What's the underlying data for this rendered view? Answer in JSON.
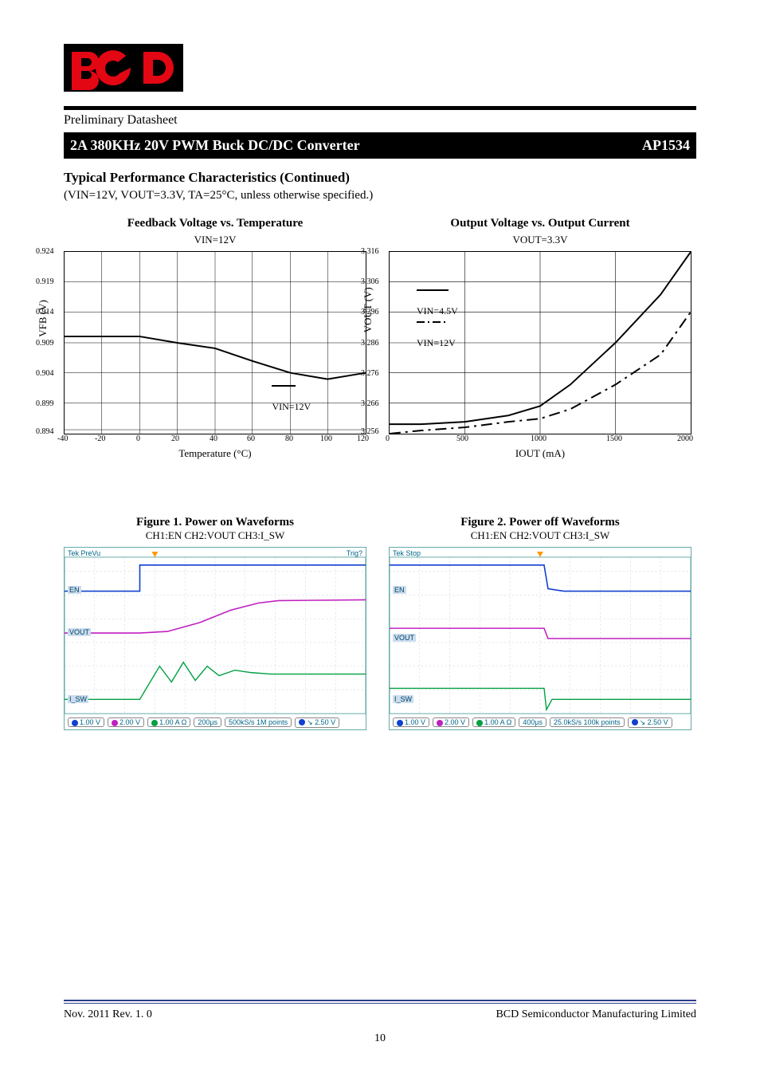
{
  "header": {
    "doc_sub": "Preliminary Datasheet",
    "banner_left": "2A 380KHz 20V PWM Buck DC/DC Converter",
    "banner_right": "AP1534"
  },
  "section": {
    "title": "Typical Performance Characteristics (Continued)",
    "cond": "(VIN=12V, VOUT=3.3V, TA=25°C, unless otherwise specified.)"
  },
  "chart1": {
    "title": "Feedback Voltage vs. Temperature",
    "sub": "VIN=12V",
    "ylabel": "VFB (V)",
    "xlabel": "Temperature (°C)",
    "legend1": "VIN=12V"
  },
  "chart2": {
    "title": "Output Voltage vs. Output Current",
    "sub": "VOUT=3.3V",
    "ylabel": "VOUT (V)",
    "xlabel": "IOUT (mA)",
    "legend1": "VIN=4.5V",
    "legend2": "VIN=12V"
  },
  "fig1": {
    "title": "Figure 1. Power on Waveforms",
    "sub": "CH1:EN CH2:VOUT CH3:I_SW",
    "ch1_label": "EN",
    "ch2_label": "VOUT",
    "ch3_label": "I_SW",
    "tek": "Tek PreVu",
    "trig": "Trig?",
    "p1": "1.00 V",
    "p2": "2.00 V",
    "p3": "1.00 A Ω",
    "tb": "200µs",
    "sr": "500kS/s 1M points",
    "tl": "2.50 V"
  },
  "fig2": {
    "title": "Figure 2. Power off Waveforms",
    "sub": "CH1:EN CH2:VOUT CH3:I_SW",
    "ch1_label": "EN",
    "ch2_label": "VOUT",
    "ch3_label": "I_SW",
    "tek": "Tek Stop",
    "p1": "1.00 V",
    "p2": "2.00 V",
    "p3": "1.00 A Ω",
    "tb": "400µs",
    "sr": "25.0kS/s 100k points",
    "tl": "2.50 V"
  },
  "footer": {
    "left": "Nov. 2011   Rev. 1. 0",
    "right": "BCD Semiconductor Manufacturing Limited",
    "page": "10"
  },
  "chart_data": [
    {
      "type": "line",
      "title": "Feedback Voltage vs. Temperature",
      "xlabel": "Temperature (°C)",
      "ylabel": "VFB (V)",
      "xlim": [
        -40,
        120
      ],
      "ylim": [
        0.894,
        0.924
      ],
      "x_ticks": [
        -40,
        -20,
        0,
        20,
        40,
        60,
        80,
        100,
        120
      ],
      "y_ticks": [
        0.894,
        0.899,
        0.904,
        0.909,
        0.914,
        0.919,
        0.924
      ],
      "series": [
        {
          "name": "VIN=12V",
          "x": [
            -40,
            -20,
            0,
            20,
            40,
            60,
            80,
            100,
            120
          ],
          "values": [
            0.91,
            0.91,
            0.91,
            0.909,
            0.908,
            0.906,
            0.904,
            0.903,
            0.904
          ]
        }
      ]
    },
    {
      "type": "line",
      "title": "Output Voltage vs. Output Current",
      "xlabel": "IOUT (mA)",
      "ylabel": "VOUT (V)",
      "xlim": [
        0,
        2000
      ],
      "ylim": [
        3.256,
        3.316
      ],
      "x_ticks": [
        0,
        500,
        1000,
        1500,
        2000
      ],
      "y_ticks": [
        3.256,
        3.266,
        3.276,
        3.286,
        3.296,
        3.306,
        3.316
      ],
      "series": [
        {
          "name": "VIN=4.5V",
          "x": [
            0,
            200,
            500,
            800,
            1000,
            1200,
            1500,
            1800,
            2000
          ],
          "values": [
            3.259,
            3.259,
            3.26,
            3.262,
            3.265,
            3.272,
            3.286,
            3.302,
            3.316
          ]
        },
        {
          "name": "VIN=12V",
          "x": [
            0,
            200,
            500,
            800,
            1000,
            1200,
            1500,
            1800,
            2000
          ],
          "values": [
            3.256,
            3.257,
            3.258,
            3.26,
            3.261,
            3.264,
            3.272,
            3.282,
            3.296
          ]
        }
      ]
    }
  ]
}
